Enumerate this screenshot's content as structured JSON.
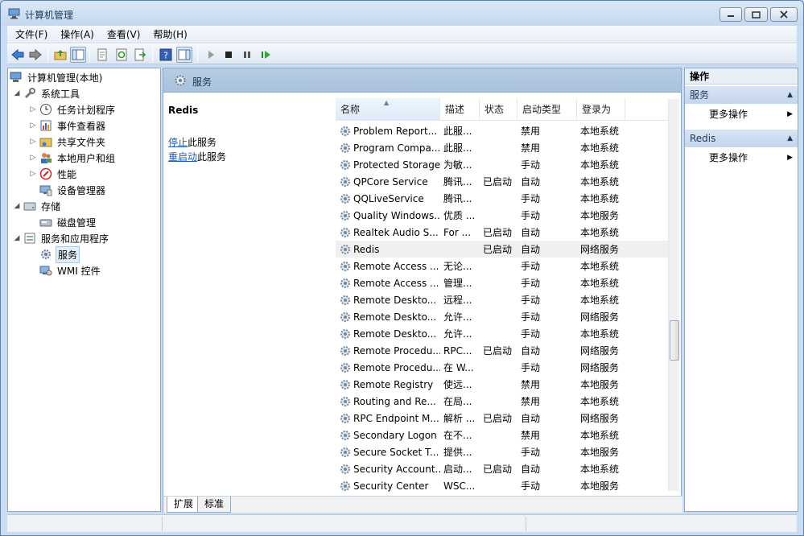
{
  "window": {
    "title": "计算机管理"
  },
  "menubar": [
    "文件(F)",
    "操作(A)",
    "查看(V)",
    "帮助(H)"
  ],
  "tree": [
    {
      "label": "计算机管理(本地)",
      "icon": "computer-management-icon",
      "arrow": ""
    },
    {
      "label": "系统工具",
      "icon": "tools-icon",
      "arrow": "▲"
    },
    {
      "label": "任务计划程序",
      "icon": "clock-icon",
      "arrow": "▷"
    },
    {
      "label": "事件查看器",
      "icon": "event-viewer-icon",
      "arrow": "▷"
    },
    {
      "label": "共享文件夹",
      "icon": "shared-folder-icon",
      "arrow": "▷"
    },
    {
      "label": "本地用户和组",
      "icon": "users-icon",
      "arrow": "▷"
    },
    {
      "label": "性能",
      "icon": "performance-icon",
      "arrow": "▷"
    },
    {
      "label": "设备管理器",
      "icon": "device-manager-icon",
      "arrow": ""
    },
    {
      "label": "存储",
      "icon": "storage-icon",
      "arrow": "▲"
    },
    {
      "label": "磁盘管理",
      "icon": "disk-icon",
      "arrow": ""
    },
    {
      "label": "服务和应用程序",
      "icon": "services-apps-icon",
      "arrow": "▲"
    },
    {
      "label": "服务",
      "icon": "services-icon",
      "arrow": ""
    },
    {
      "label": "WMI 控件",
      "icon": "wmi-icon",
      "arrow": ""
    }
  ],
  "main": {
    "header": "服务",
    "selected_service": "Redis",
    "actions": [
      {
        "link": "停止",
        "rest": "此服务"
      },
      {
        "link": "重启动",
        "rest": "此服务"
      }
    ],
    "columns": [
      "名称",
      "描述",
      "状态",
      "启动类型",
      "登录为"
    ],
    "rows": [
      [
        "Problem Report...",
        "此服...",
        "",
        "禁用",
        "本地系统"
      ],
      [
        "Program Compa...",
        "此服...",
        "",
        "禁用",
        "本地系统"
      ],
      [
        "Protected Storage",
        "为敏...",
        "",
        "手动",
        "本地系统"
      ],
      [
        "QPCore Service",
        "腾讯...",
        "已启动",
        "自动",
        "本地系统"
      ],
      [
        "QQLiveService",
        "腾讯...",
        "",
        "手动",
        "本地系统"
      ],
      [
        "Quality Windows...",
        "优质 ...",
        "",
        "手动",
        "本地服务"
      ],
      [
        "Realtek Audio S...",
        "For ...",
        "已启动",
        "自动",
        "本地系统"
      ],
      [
        "Redis",
        "",
        "已启动",
        "自动",
        "网络服务"
      ],
      [
        "Remote Access ...",
        "无论...",
        "",
        "手动",
        "本地系统"
      ],
      [
        "Remote Access ...",
        "管理...",
        "",
        "手动",
        "本地系统"
      ],
      [
        "Remote Deskto...",
        "远程...",
        "",
        "手动",
        "本地系统"
      ],
      [
        "Remote Deskto...",
        "允许...",
        "",
        "手动",
        "网络服务"
      ],
      [
        "Remote Deskto...",
        "允许...",
        "",
        "手动",
        "本地系统"
      ],
      [
        "Remote Procedu...",
        "RPC...",
        "已启动",
        "自动",
        "网络服务"
      ],
      [
        "Remote Procedu...",
        "在 W...",
        "",
        "手动",
        "网络服务"
      ],
      [
        "Remote Registry",
        "使远...",
        "",
        "禁用",
        "本地服务"
      ],
      [
        "Routing and Re...",
        "在局...",
        "",
        "禁用",
        "本地系统"
      ],
      [
        "RPC Endpoint M...",
        "解析 ...",
        "已启动",
        "自动",
        "网络服务"
      ],
      [
        "Secondary Logon",
        "在不...",
        "",
        "禁用",
        "本地系统"
      ],
      [
        "Secure Socket T...",
        "提供...",
        "",
        "手动",
        "本地服务"
      ],
      [
        "Security Account...",
        "启动...",
        "已启动",
        "自动",
        "本地系统"
      ],
      [
        "Security Center",
        "WSC...",
        "",
        "手动",
        "本地服务"
      ]
    ],
    "tabs": [
      "扩展",
      "标准"
    ]
  },
  "action_pane": {
    "title": "操作",
    "sections": [
      {
        "label": "服务",
        "item": "更多操作"
      },
      {
        "label": "Redis",
        "item": "更多操作"
      }
    ]
  }
}
